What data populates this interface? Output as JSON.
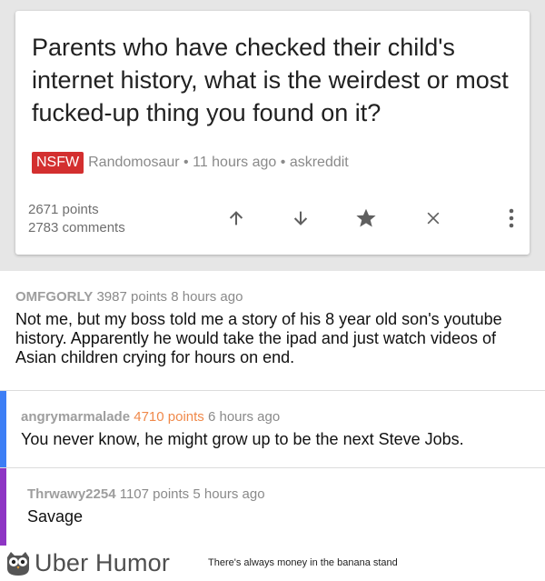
{
  "post": {
    "title": "Parents who have checked their child's internet history, what is the weirdest or most fucked-up thing you found on it?",
    "nsfw_label": "NSFW",
    "meta": "Randomosaur • 11 hours ago • askreddit",
    "points": "2671 points",
    "comments": "2783 comments",
    "icons": [
      "upvote-icon",
      "downvote-icon",
      "star-icon",
      "close-icon",
      "more-vert-icon"
    ]
  },
  "comments": [
    {
      "author": "OMFGORLY",
      "points": "3987 points",
      "time": "8 hours ago",
      "body": "Not me, but my boss told me a story of his 8 year old son's youtube history. Apparently he would take the ipad and just watch videos of Asian children crying for hours on end."
    },
    {
      "author": "angrymarmalade",
      "points": "4710 points",
      "time": "6 hours ago",
      "body": "You never know, he might grow up to be the next Steve Jobs.",
      "depth_color": "#3d7ef5",
      "points_color": "#f0894a"
    },
    {
      "author": "Thrwawy2254",
      "points": "1107 points",
      "time": "5 hours ago",
      "body": "Savage",
      "depth_color": "#8e35c4"
    }
  ],
  "footer": {
    "brand": "Uber Humor",
    "tagline": "There's always money in the banana stand"
  },
  "colors": {
    "nsfw": "#d32f2f",
    "background": "#e6e6e6"
  }
}
